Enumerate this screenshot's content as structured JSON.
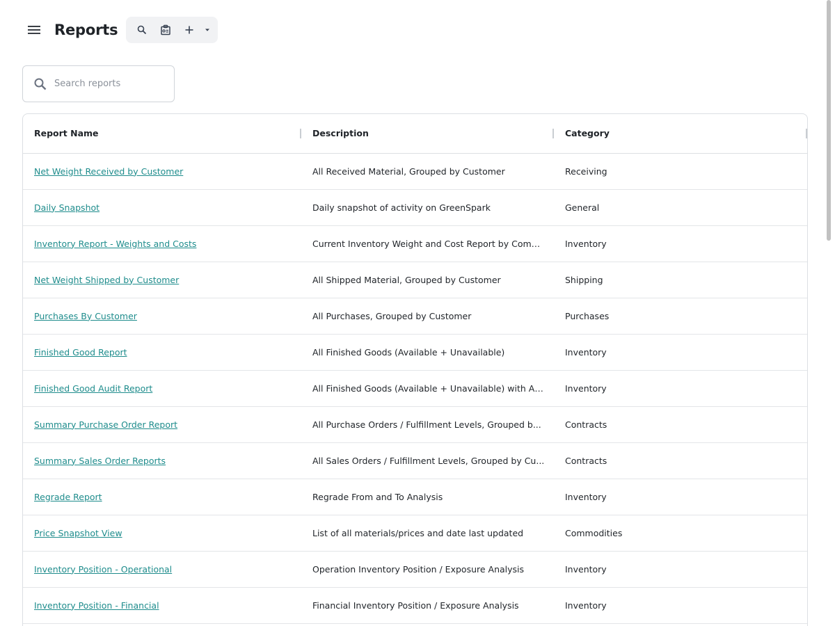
{
  "header": {
    "title": "Reports",
    "icons": {
      "menu": "menu-icon",
      "search": "search-icon",
      "clipboard": "clipboard-icon",
      "add": "plus-icon",
      "dropdown": "caret-down-icon"
    }
  },
  "search": {
    "placeholder": "Search reports",
    "value": ""
  },
  "table": {
    "columns": [
      "Report Name",
      "Description",
      "Category"
    ],
    "rows": [
      {
        "name": "Net Weight Received by Customer",
        "description": "All Received Material, Grouped by Customer",
        "category": "Receiving"
      },
      {
        "name": "Daily Snapshot",
        "description": "Daily snapshot of activity on GreenSpark",
        "category": "General"
      },
      {
        "name": "Inventory Report - Weights and Costs",
        "description": "Current Inventory Weight and Cost Report by Comm...",
        "category": "Inventory"
      },
      {
        "name": "Net Weight Shipped by Customer",
        "description": "All Shipped Material, Grouped by Customer",
        "category": "Shipping"
      },
      {
        "name": "Purchases By Customer",
        "description": "All Purchases, Grouped by Customer",
        "category": "Purchases"
      },
      {
        "name": "Finished Good Report",
        "description": "All Finished Goods (Available + Unavailable)",
        "category": "Inventory"
      },
      {
        "name": "Finished Good Audit Report",
        "description": "All Finished Goods (Available + Unavailable) with Au...",
        "category": "Inventory"
      },
      {
        "name": "Summary Purchase Order Report",
        "description": "All Purchase Orders / Fulfillment Levels, Grouped b...",
        "category": "Contracts"
      },
      {
        "name": "Summary Sales Order Reports",
        "description": "All Sales Orders / Fulfillment Levels, Grouped by Cu...",
        "category": "Contracts"
      },
      {
        "name": "Regrade Report",
        "description": "Regrade From and To Analysis",
        "category": "Inventory"
      },
      {
        "name": "Price Snapshot View",
        "description": "List of all materials/prices and date last updated",
        "category": "Commodities"
      },
      {
        "name": "Inventory Position - Operational",
        "description": "Operation Inventory Position / Exposure Analysis",
        "category": "Inventory"
      },
      {
        "name": "Inventory Position - Financial",
        "description": "Financial Inventory Position / Exposure Analysis",
        "category": "Inventory"
      }
    ]
  },
  "colors": {
    "link": "#1e8c8c",
    "toolbar_bg": "#f1f2f4",
    "border": "#dcdfe3"
  }
}
